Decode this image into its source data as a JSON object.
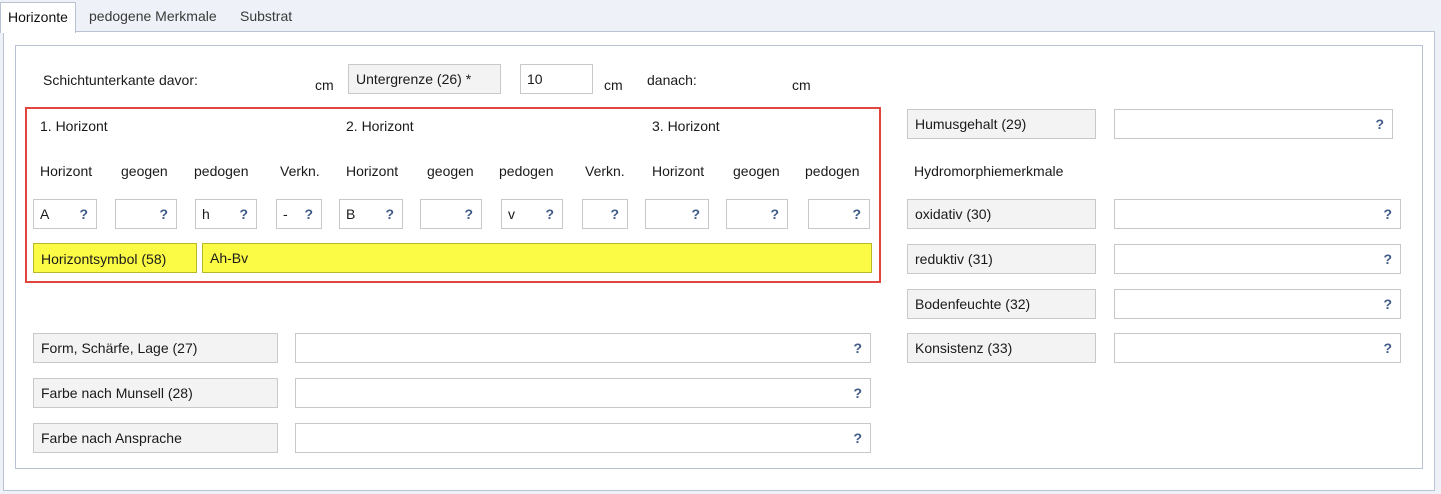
{
  "tabs": [
    {
      "label": "Horizonte",
      "active": true
    },
    {
      "label": "pedogene Merkmale",
      "active": false
    },
    {
      "label": "Substrat",
      "active": false
    }
  ],
  "top_row": {
    "schichtunterkante_label": "Schichtunterkante davor:",
    "unit1": "cm",
    "untergrenze_label": "Untergrenze (26) *",
    "untergrenze_value": "10",
    "unit2": "cm",
    "danach_label": "danach:",
    "unit3": "cm"
  },
  "horizons": {
    "headers": [
      "1. Horizont",
      "2. Horizont",
      "3. Horizont"
    ],
    "columns": [
      "Horizont",
      "geogen",
      "pedogen",
      "Verkn.",
      "Horizont",
      "geogen",
      "pedogen",
      "Verkn.",
      "Horizont",
      "geogen",
      "pedogen"
    ],
    "values": [
      "A",
      "",
      "h",
      "-",
      "B",
      "",
      "v",
      "",
      "",
      "",
      ""
    ],
    "help": "?"
  },
  "horizontsymbol": {
    "label": "Horizontsymbol (58)",
    "value": "Ah-Bv"
  },
  "left_fields": [
    {
      "label": "Form, Schärfe, Lage (27)",
      "value": ""
    },
    {
      "label": "Farbe nach Munsell (28)",
      "value": ""
    },
    {
      "label": "Farbe nach Ansprache",
      "value": ""
    }
  ],
  "right": {
    "humus_label": "Humusgehalt (29)",
    "hydro_heading": "Hydromorphiemerkmale",
    "fields": [
      {
        "label": "oxidativ (30)",
        "value": ""
      },
      {
        "label": "reduktiv (31)",
        "value": ""
      },
      {
        "label": "Bodenfeuchte (32)",
        "value": ""
      },
      {
        "label": "Konsistenz (33)",
        "value": ""
      }
    ]
  },
  "colors": {
    "highlight": "#fbfb45",
    "outline": "#e0463d",
    "help_icon": "#3f5b86"
  }
}
